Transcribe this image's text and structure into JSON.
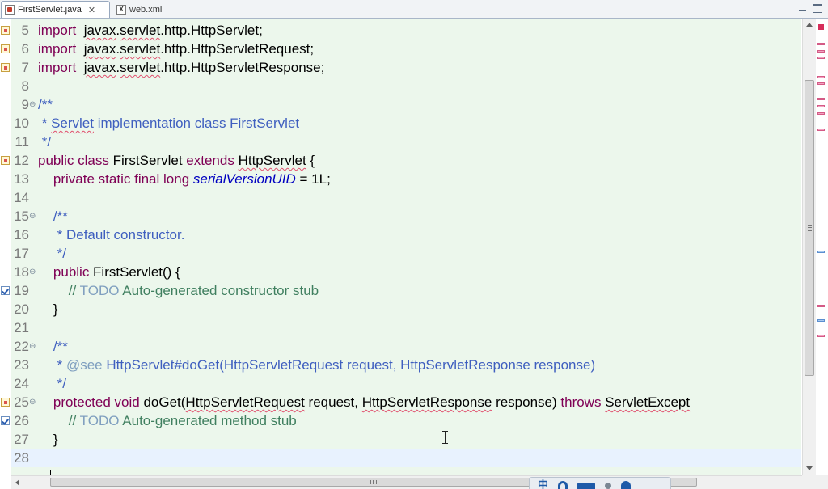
{
  "tabs": [
    {
      "label": "FirstServlet.java",
      "close": "✕",
      "active": true,
      "icon": "java-file-icon"
    },
    {
      "label": "web.xml",
      "active": false,
      "icon": "xml-file-icon"
    }
  ],
  "xml_icon_glyph": "X",
  "colors": {
    "editor_bg": "#ecf7ec",
    "keyword": "#7f0055",
    "javadoc": "#3f5fbf",
    "javadoc_tag": "#7f9fbf",
    "comment": "#3f7f5f",
    "field": "#0000c0",
    "current_line": "#e8f2fe"
  },
  "editor": {
    "lines": [
      {
        "n": "5",
        "tokens": [
          [
            "kw",
            "import"
          ],
          [
            "",
            "  "
          ],
          [
            "sq",
            "javax"
          ],
          [
            "",
            "."
          ],
          [
            "sq",
            "servlet"
          ],
          [
            "",
            ".http.HttpServlet;"
          ]
        ]
      },
      {
        "n": "6",
        "tokens": [
          [
            "kw",
            "import"
          ],
          [
            "",
            "  "
          ],
          [
            "sq",
            "javax"
          ],
          [
            "",
            "."
          ],
          [
            "sq",
            "servlet"
          ],
          [
            "",
            ".http.HttpServletRequest;"
          ]
        ]
      },
      {
        "n": "7",
        "tokens": [
          [
            "kw",
            "import"
          ],
          [
            "",
            "  "
          ],
          [
            "sq",
            "javax"
          ],
          [
            "",
            "."
          ],
          [
            "sq",
            "servlet"
          ],
          [
            "",
            ".http.HttpServletResponse;"
          ]
        ]
      },
      {
        "n": "8",
        "tokens": []
      },
      {
        "n": "9",
        "tokens": [
          [
            "jd",
            "/**"
          ]
        ]
      },
      {
        "n": "10",
        "tokens": [
          [
            "jd",
            " * "
          ],
          [
            "jd sq",
            "Servlet"
          ],
          [
            "jd",
            " implementation class "
          ],
          [
            "jd",
            "FirstServlet"
          ]
        ]
      },
      {
        "n": "11",
        "tokens": [
          [
            "jd",
            " */"
          ]
        ]
      },
      {
        "n": "12",
        "tokens": [
          [
            "kw",
            "public"
          ],
          [
            "",
            " "
          ],
          [
            "kw",
            "class"
          ],
          [
            "",
            " FirstServlet "
          ],
          [
            "kw",
            "extends"
          ],
          [
            "",
            " "
          ],
          [
            "sq",
            "HttpServlet"
          ],
          [
            "",
            " {"
          ]
        ]
      },
      {
        "n": "13",
        "tokens": [
          [
            "",
            "    "
          ],
          [
            "kw",
            "private"
          ],
          [
            "",
            " "
          ],
          [
            "kw",
            "static"
          ],
          [
            "",
            " "
          ],
          [
            "kw",
            "final"
          ],
          [
            "",
            " "
          ],
          [
            "kw",
            "long"
          ],
          [
            "",
            " "
          ],
          [
            "field",
            "serialVersionUID"
          ],
          [
            "",
            " = 1L;"
          ]
        ]
      },
      {
        "n": "14",
        "tokens": []
      },
      {
        "n": "15",
        "tokens": [
          [
            "",
            "    "
          ],
          [
            "jd",
            "/**"
          ]
        ]
      },
      {
        "n": "16",
        "tokens": [
          [
            "",
            "    "
          ],
          [
            "jd",
            " * Default constructor."
          ]
        ]
      },
      {
        "n": "17",
        "tokens": [
          [
            "",
            "    "
          ],
          [
            "jd",
            " */"
          ]
        ]
      },
      {
        "n": "18",
        "tokens": [
          [
            "",
            "    "
          ],
          [
            "kw",
            "public"
          ],
          [
            "",
            " FirstServlet() {"
          ]
        ]
      },
      {
        "n": "19",
        "tokens": [
          [
            "",
            "        "
          ],
          [
            "cm",
            "// "
          ],
          [
            "todo",
            "TODO"
          ],
          [
            "cm",
            " Auto-generated constructor stub"
          ]
        ]
      },
      {
        "n": "20",
        "tokens": [
          [
            "",
            "    }"
          ]
        ]
      },
      {
        "n": "21",
        "tokens": []
      },
      {
        "n": "22",
        "tokens": [
          [
            "",
            "    "
          ],
          [
            "jd",
            "/**"
          ]
        ]
      },
      {
        "n": "23",
        "tokens": [
          [
            "",
            "    "
          ],
          [
            "jd",
            " * "
          ],
          [
            "tag",
            "@see"
          ],
          [
            "jd",
            " HttpServlet#doGet(HttpServletRequest request, HttpServletResponse response)"
          ]
        ]
      },
      {
        "n": "24",
        "tokens": [
          [
            "",
            "    "
          ],
          [
            "jd",
            " */"
          ]
        ]
      },
      {
        "n": "25",
        "tokens": [
          [
            "",
            "    "
          ],
          [
            "kw",
            "protected"
          ],
          [
            "",
            " "
          ],
          [
            "kw",
            "void"
          ],
          [
            "",
            " doGet("
          ],
          [
            "sq",
            "HttpServletRequest"
          ],
          [
            "",
            " request, "
          ],
          [
            "sq",
            "HttpServletResponse"
          ],
          [
            "",
            " response) "
          ],
          [
            "kw",
            "throws"
          ],
          [
            "",
            " "
          ],
          [
            "sq",
            "ServletExcept"
          ]
        ]
      },
      {
        "n": "26",
        "tokens": [
          [
            "",
            "        "
          ],
          [
            "cm",
            "// "
          ],
          [
            "todo",
            "TODO"
          ],
          [
            "cm",
            " Auto-generated method stub"
          ]
        ]
      },
      {
        "n": "27",
        "tokens": [
          [
            "",
            "    }"
          ]
        ]
      },
      {
        "n": "28",
        "tokens": [],
        "current": true
      }
    ],
    "fold_lines": [
      "9",
      "15",
      "18",
      "22",
      "25"
    ],
    "warning_lines": [
      "5",
      "6",
      "7",
      "12",
      "25"
    ],
    "task_lines": [
      "19",
      "26"
    ]
  },
  "ime": {
    "label": "中"
  }
}
